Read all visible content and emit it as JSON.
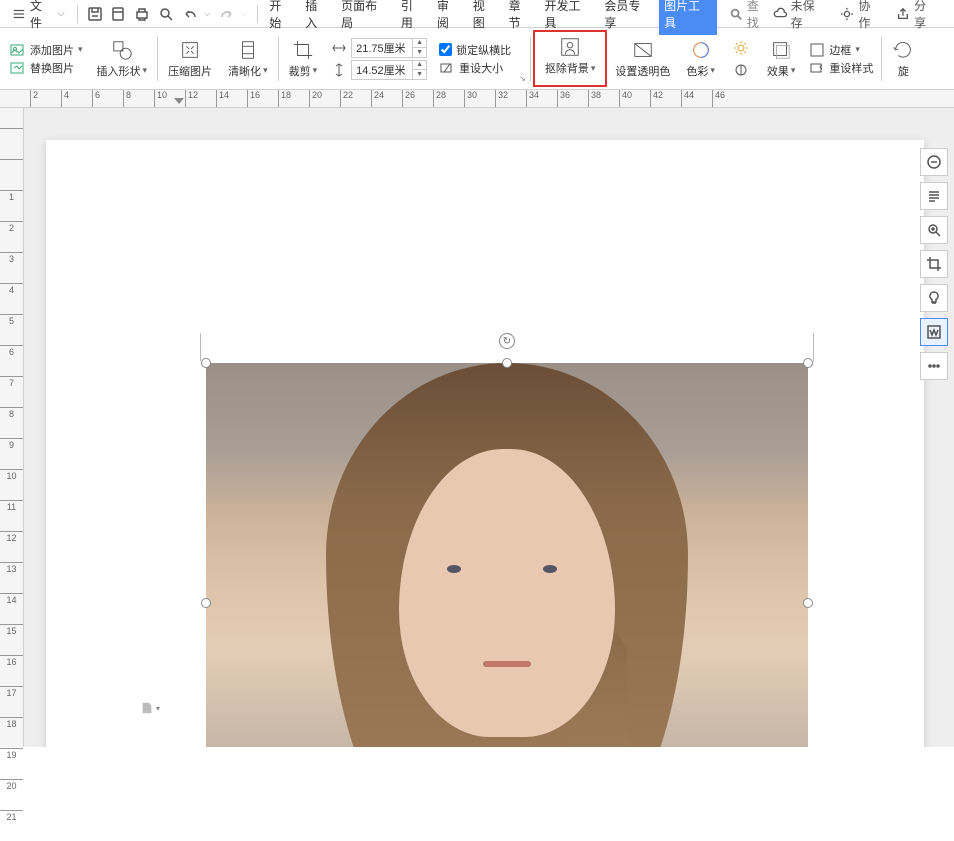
{
  "menu": {
    "file_label": "文件",
    "tabs": [
      "开始",
      "插入",
      "页面布局",
      "引用",
      "审阅",
      "视图",
      "章节",
      "开发工具",
      "会员专享",
      "图片工具"
    ],
    "active_tab_index": 9,
    "search_placeholder": "查找",
    "right": {
      "unsaved": "未保存",
      "collab": "协作",
      "share": "分享"
    }
  },
  "ribbon": {
    "add_image": "添加图片",
    "replace_image": "替换图片",
    "insert_shape": "插入形状",
    "compress": "压缩图片",
    "sharpen": "清晰化",
    "crop": "裁剪",
    "width_label_icon": "width",
    "height_label_icon": "height",
    "width_value": "21.75厘米",
    "height_value": "14.52厘米",
    "lock_ratio": "锁定纵横比",
    "reset_size": "重设大小",
    "remove_bg": "抠除背景",
    "set_transparent": "设置透明色",
    "color": "色彩",
    "effects": "效果",
    "border": "边框",
    "reset_style": "重设样式",
    "rotate": "旋"
  },
  "ruler_h_numbers": [
    "2",
    "4",
    "6",
    "8",
    "10",
    "12",
    "14",
    "16",
    "18",
    "20",
    "22",
    "24",
    "26",
    "28",
    "30",
    "32",
    "34",
    "36",
    "38",
    "40",
    "42",
    "44",
    "46"
  ],
  "ruler_h_marker": "26",
  "ruler_v_numbers": [
    "",
    "",
    "1",
    "2",
    "3",
    "4",
    "5",
    "6",
    "7",
    "8",
    "9",
    "10",
    "11",
    "12",
    "13",
    "14",
    "15",
    "16",
    "17",
    "18",
    "19",
    "20",
    "21"
  ],
  "side_icons": [
    "minus",
    "layout",
    "zoom",
    "crop",
    "bulb",
    "word",
    "more"
  ]
}
